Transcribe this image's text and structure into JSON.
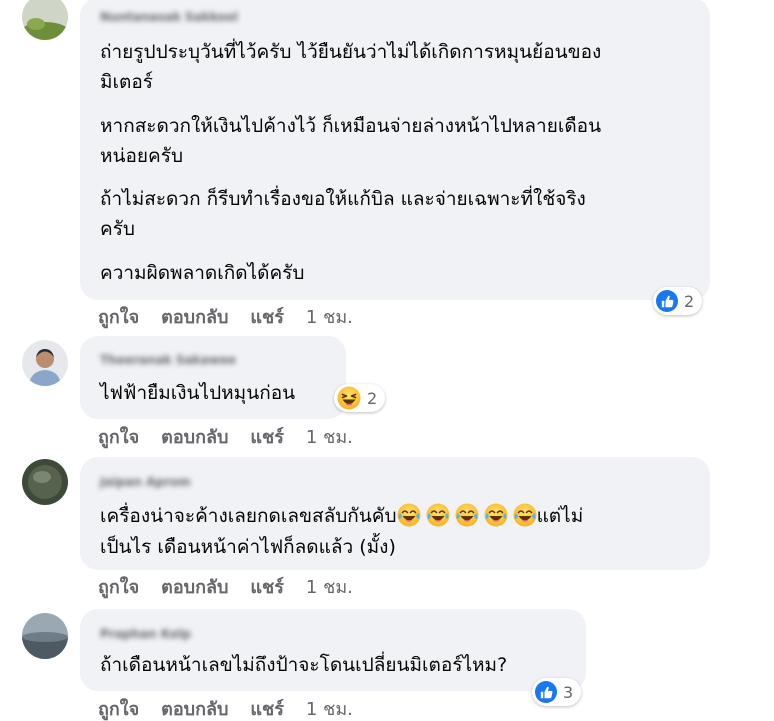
{
  "comments": [
    {
      "author": "Nuntanasak Sakkool",
      "paragraphs": [
        "ถ่ายรูปประบุวันที่ไว้ครับ ไว้ยืนยันว่าไม่ได้เกิดการหมุนย้อนของ",
        "มิเตอร์",
        "หากสะดวกให้เงินไปค้างไว้ ก็เหมือนจ่ายล่างหน้าไปหลายเดือน",
        "หน่อยครับ",
        "ถ้าไม่สะดวก ก็รีบทำเรื่องขอให้แก้บิล และจ่ายเฉพาะที่ใช้จริง",
        "ครับ",
        "ความผิดพลาดเกิดได้ครับ"
      ],
      "reaction": {
        "icon": "like-icon",
        "count": "2"
      },
      "actions": {
        "like": "ถูกใจ",
        "reply": "ตอบกลับ",
        "share": "แชร์",
        "time": "1 ชม."
      }
    },
    {
      "author": "Theeranak Sakawee",
      "text": "ไฟฟ้ายืมเงินไปหมุนก่อน",
      "reaction": {
        "icon": "haha-icon",
        "count": "2"
      },
      "actions": {
        "like": "ถูกใจ",
        "reply": "ตอบกลับ",
        "share": "แชร์",
        "time": "1 ชม."
      }
    },
    {
      "author": "Jaipan Aprom",
      "line1_before": "เครื่องน่าจะค้างเลยกดเลขสลับกันคับ",
      "line1_after": "แต่ไม่",
      "line2": "เป็นไร เดือนหน้าค่าไฟก็ลดแล้ว (มั้ง)",
      "emoji_icon": "laughing-tears-emoji-icon",
      "actions": {
        "like": "ถูกใจ",
        "reply": "ตอบกลับ",
        "share": "แชร์",
        "time": "1 ชม."
      }
    },
    {
      "author": "Praphan Kolp",
      "text": "ถ้าเดือนหน้าเลขไม่ถึงป้าจะโดนเปลี่ยนมิเตอร์ไหม?",
      "reaction": {
        "icon": "like-icon",
        "count": "3"
      },
      "actions": {
        "like": "ถูกใจ",
        "reply": "ตอบกลับ",
        "share": "แชร์",
        "time": "1 ชม."
      }
    }
  ],
  "colors": {
    "bubble": "#f0f2f5",
    "like_blue": "#1877f2",
    "meta_gray": "#65676b"
  }
}
